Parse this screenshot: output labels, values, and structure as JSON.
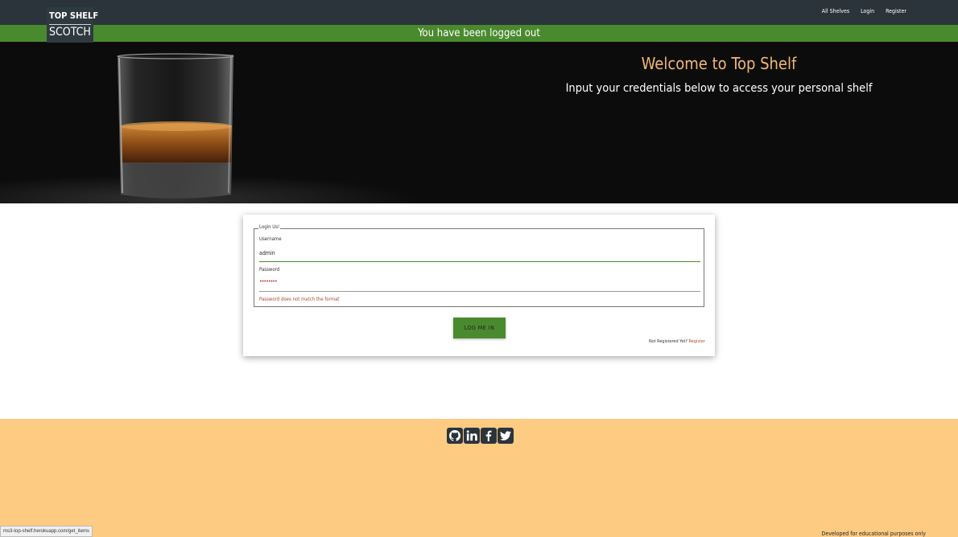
{
  "brand": {
    "line1": "TOP SHELF",
    "line2": "SCOTCH"
  },
  "nav": {
    "items": [
      "All Shelves",
      "Login",
      "Register"
    ]
  },
  "flash": {
    "message": "You have been logged out"
  },
  "hero": {
    "title": "Welcome to Top Shelf",
    "subtitle": "Input your credentials below to access your personal shelf"
  },
  "login": {
    "legend": "Login Us!",
    "username_label": "Username",
    "username_value": "admin",
    "password_label": "Password",
    "password_value": "••••••••",
    "error": "Password does not match the format",
    "button": "LOG ME IN",
    "not_registered": "Not Registered Yet?",
    "register_link": "Register"
  },
  "footer": {
    "icons": [
      "github-icon",
      "linkedin-icon",
      "facebook-icon",
      "twitter-icon"
    ],
    "note": "Developed for educational purposes only"
  },
  "status_bar": {
    "url": "ms3-top-shelf.herokuapp.com/get_items"
  },
  "colors": {
    "navbar": "#2b343b",
    "accent_green": "#4a8a2f",
    "hero_title": "#f2b772",
    "footer_bg": "#fdcb82",
    "error": "#b0463a"
  }
}
